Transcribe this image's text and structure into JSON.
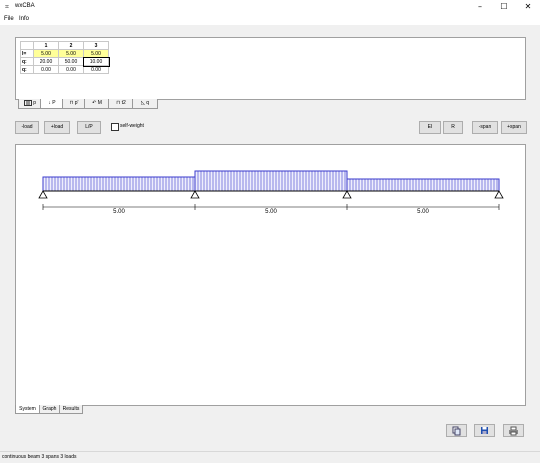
{
  "window": {
    "app_icon": "beam-app-icon",
    "title": "wxCBA"
  },
  "menu": [
    "File",
    "Info"
  ],
  "grid": {
    "columns": [
      "1",
      "2",
      "3"
    ],
    "rows": [
      {
        "label": "l=",
        "values": [
          "5.00",
          "5.00",
          "5.00"
        ]
      },
      {
        "label": "q:",
        "values": [
          "20.00",
          "50.00",
          "10.00"
        ]
      },
      {
        "label": "q:",
        "values": [
          "0.00",
          "0.00",
          "0.00"
        ]
      }
    ]
  },
  "load_tabs": [
    "p",
    "P",
    "M",
    "t2",
    "t1",
    "q"
  ],
  "toolbar": {
    "minus_load": "-load",
    "plus_load": "+load",
    "lp": "L/P",
    "self_weight": "self-weight",
    "ei": "EI",
    "r": "R",
    "minus_span": "-span",
    "plus_span": "+span"
  },
  "spans": [
    "5.00",
    "5.00",
    "5.00"
  ],
  "bottom_tabs": [
    "System",
    "Graph",
    "Results"
  ],
  "icons": {
    "copy": "copy-icon",
    "save": "save-icon",
    "print": "print-icon"
  },
  "status": "continuous beam 3 spans 3 loads"
}
